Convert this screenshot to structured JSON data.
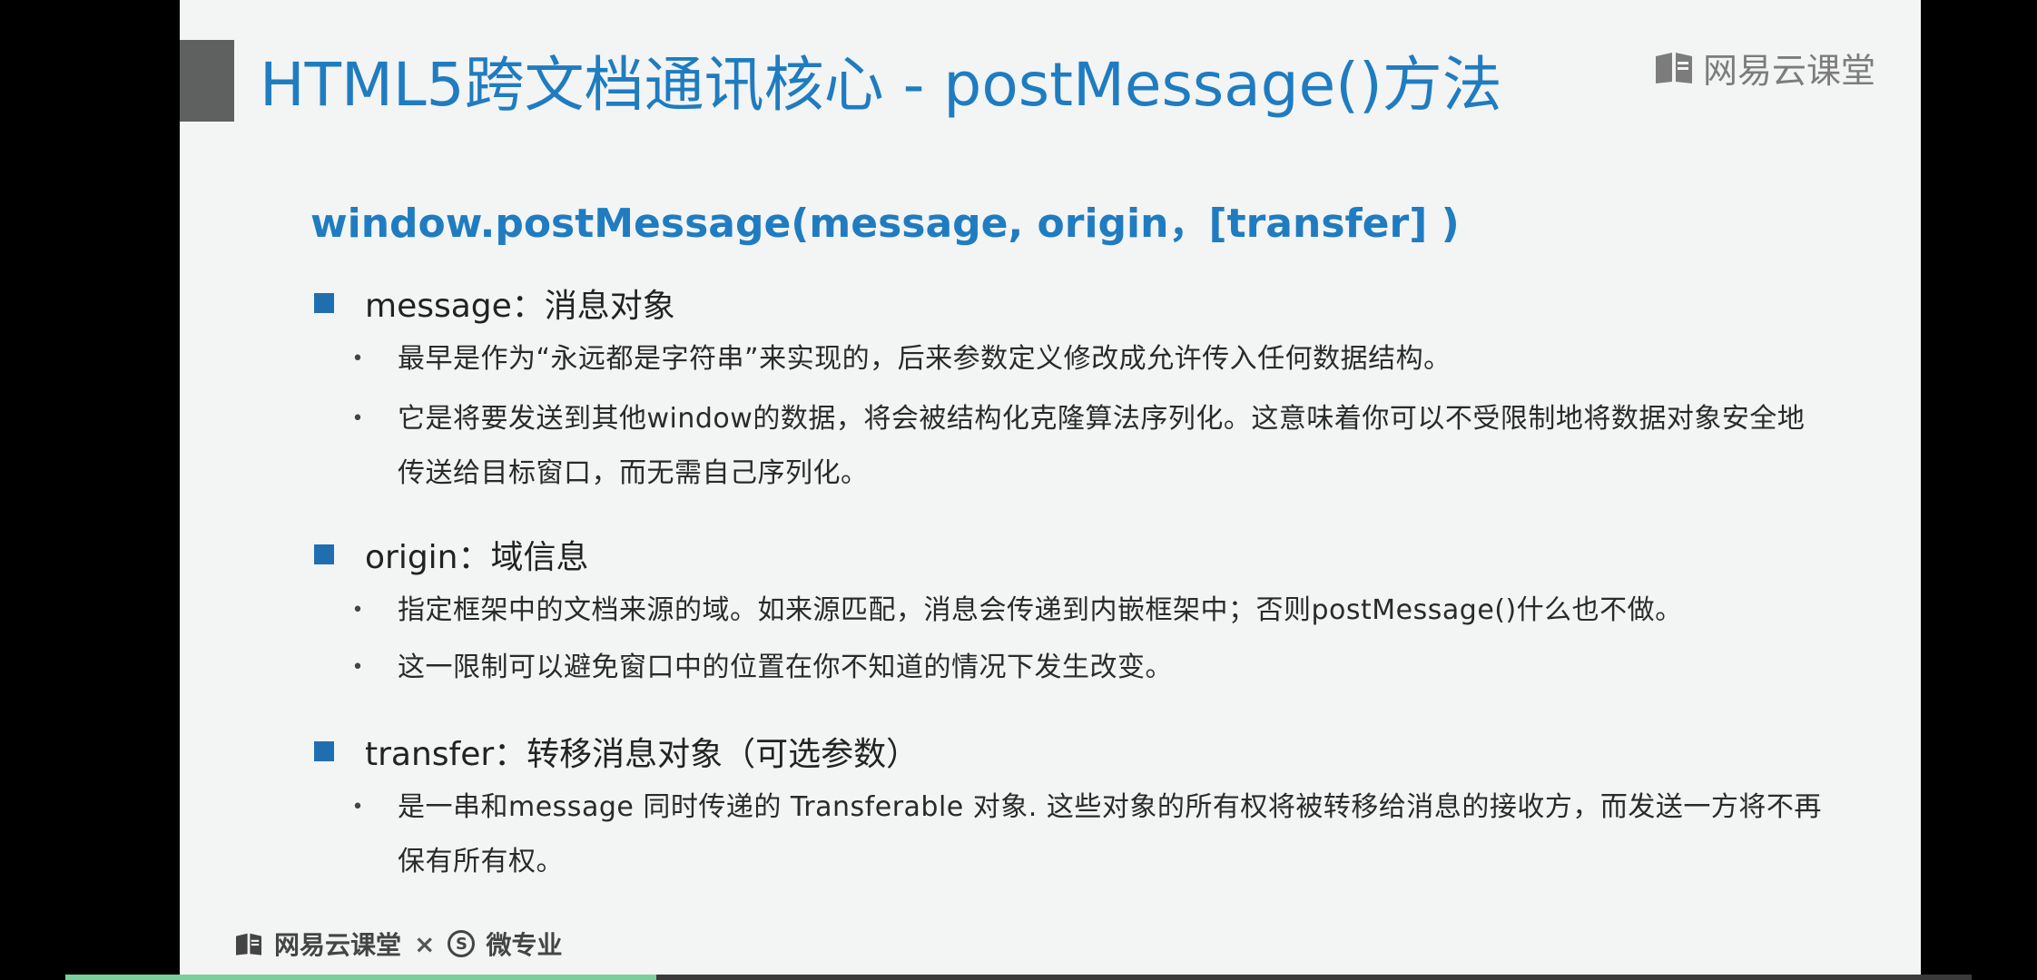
{
  "header": {
    "title": "HTML5跨文档通讯核心 - postMessage()方法",
    "brand": "网易云课堂",
    "brand_icon": "book-icon"
  },
  "signature": "window.postMessage(message, origin，[transfer] )",
  "sections": [
    {
      "heading": "message：消息对象",
      "bullets": [
        "最早是作为“永远都是字符串”来实现的，后来参数定义修改成允许传入任何数据结构。",
        "它是将要发送到其他window的数据，将会被结构化克隆算法序列化。这意味着你可以不受限制地将数据对象安全地传送给目标窗口，而无需自己序列化。"
      ]
    },
    {
      "heading": "origin：域信息",
      "bullets": [
        "指定框架中的文档来源的域。如来源匹配，消息会传递到内嵌框架中；否则postMessage()什么也不做。",
        "这一限制可以避免窗口中的位置在你不知道的情况下发生改变。"
      ]
    },
    {
      "heading": "transfer：转移消息对象（可选参数）",
      "bullets": [
        "是一串和message 同时传递的 Transferable 对象. 这些对象的所有权将被转移给消息的接收方，而发送一方将不再保有所有权。"
      ]
    }
  ],
  "footer": {
    "brand": "网易云课堂",
    "separator": "×",
    "partner_badge": "S",
    "partner": "微专业"
  },
  "playback": {
    "progress_fraction": 0.31
  },
  "colors": {
    "title_blue": "#1f7cc0",
    "bullet_square": "#1f6fb0",
    "progress": "#7ccf9c"
  }
}
